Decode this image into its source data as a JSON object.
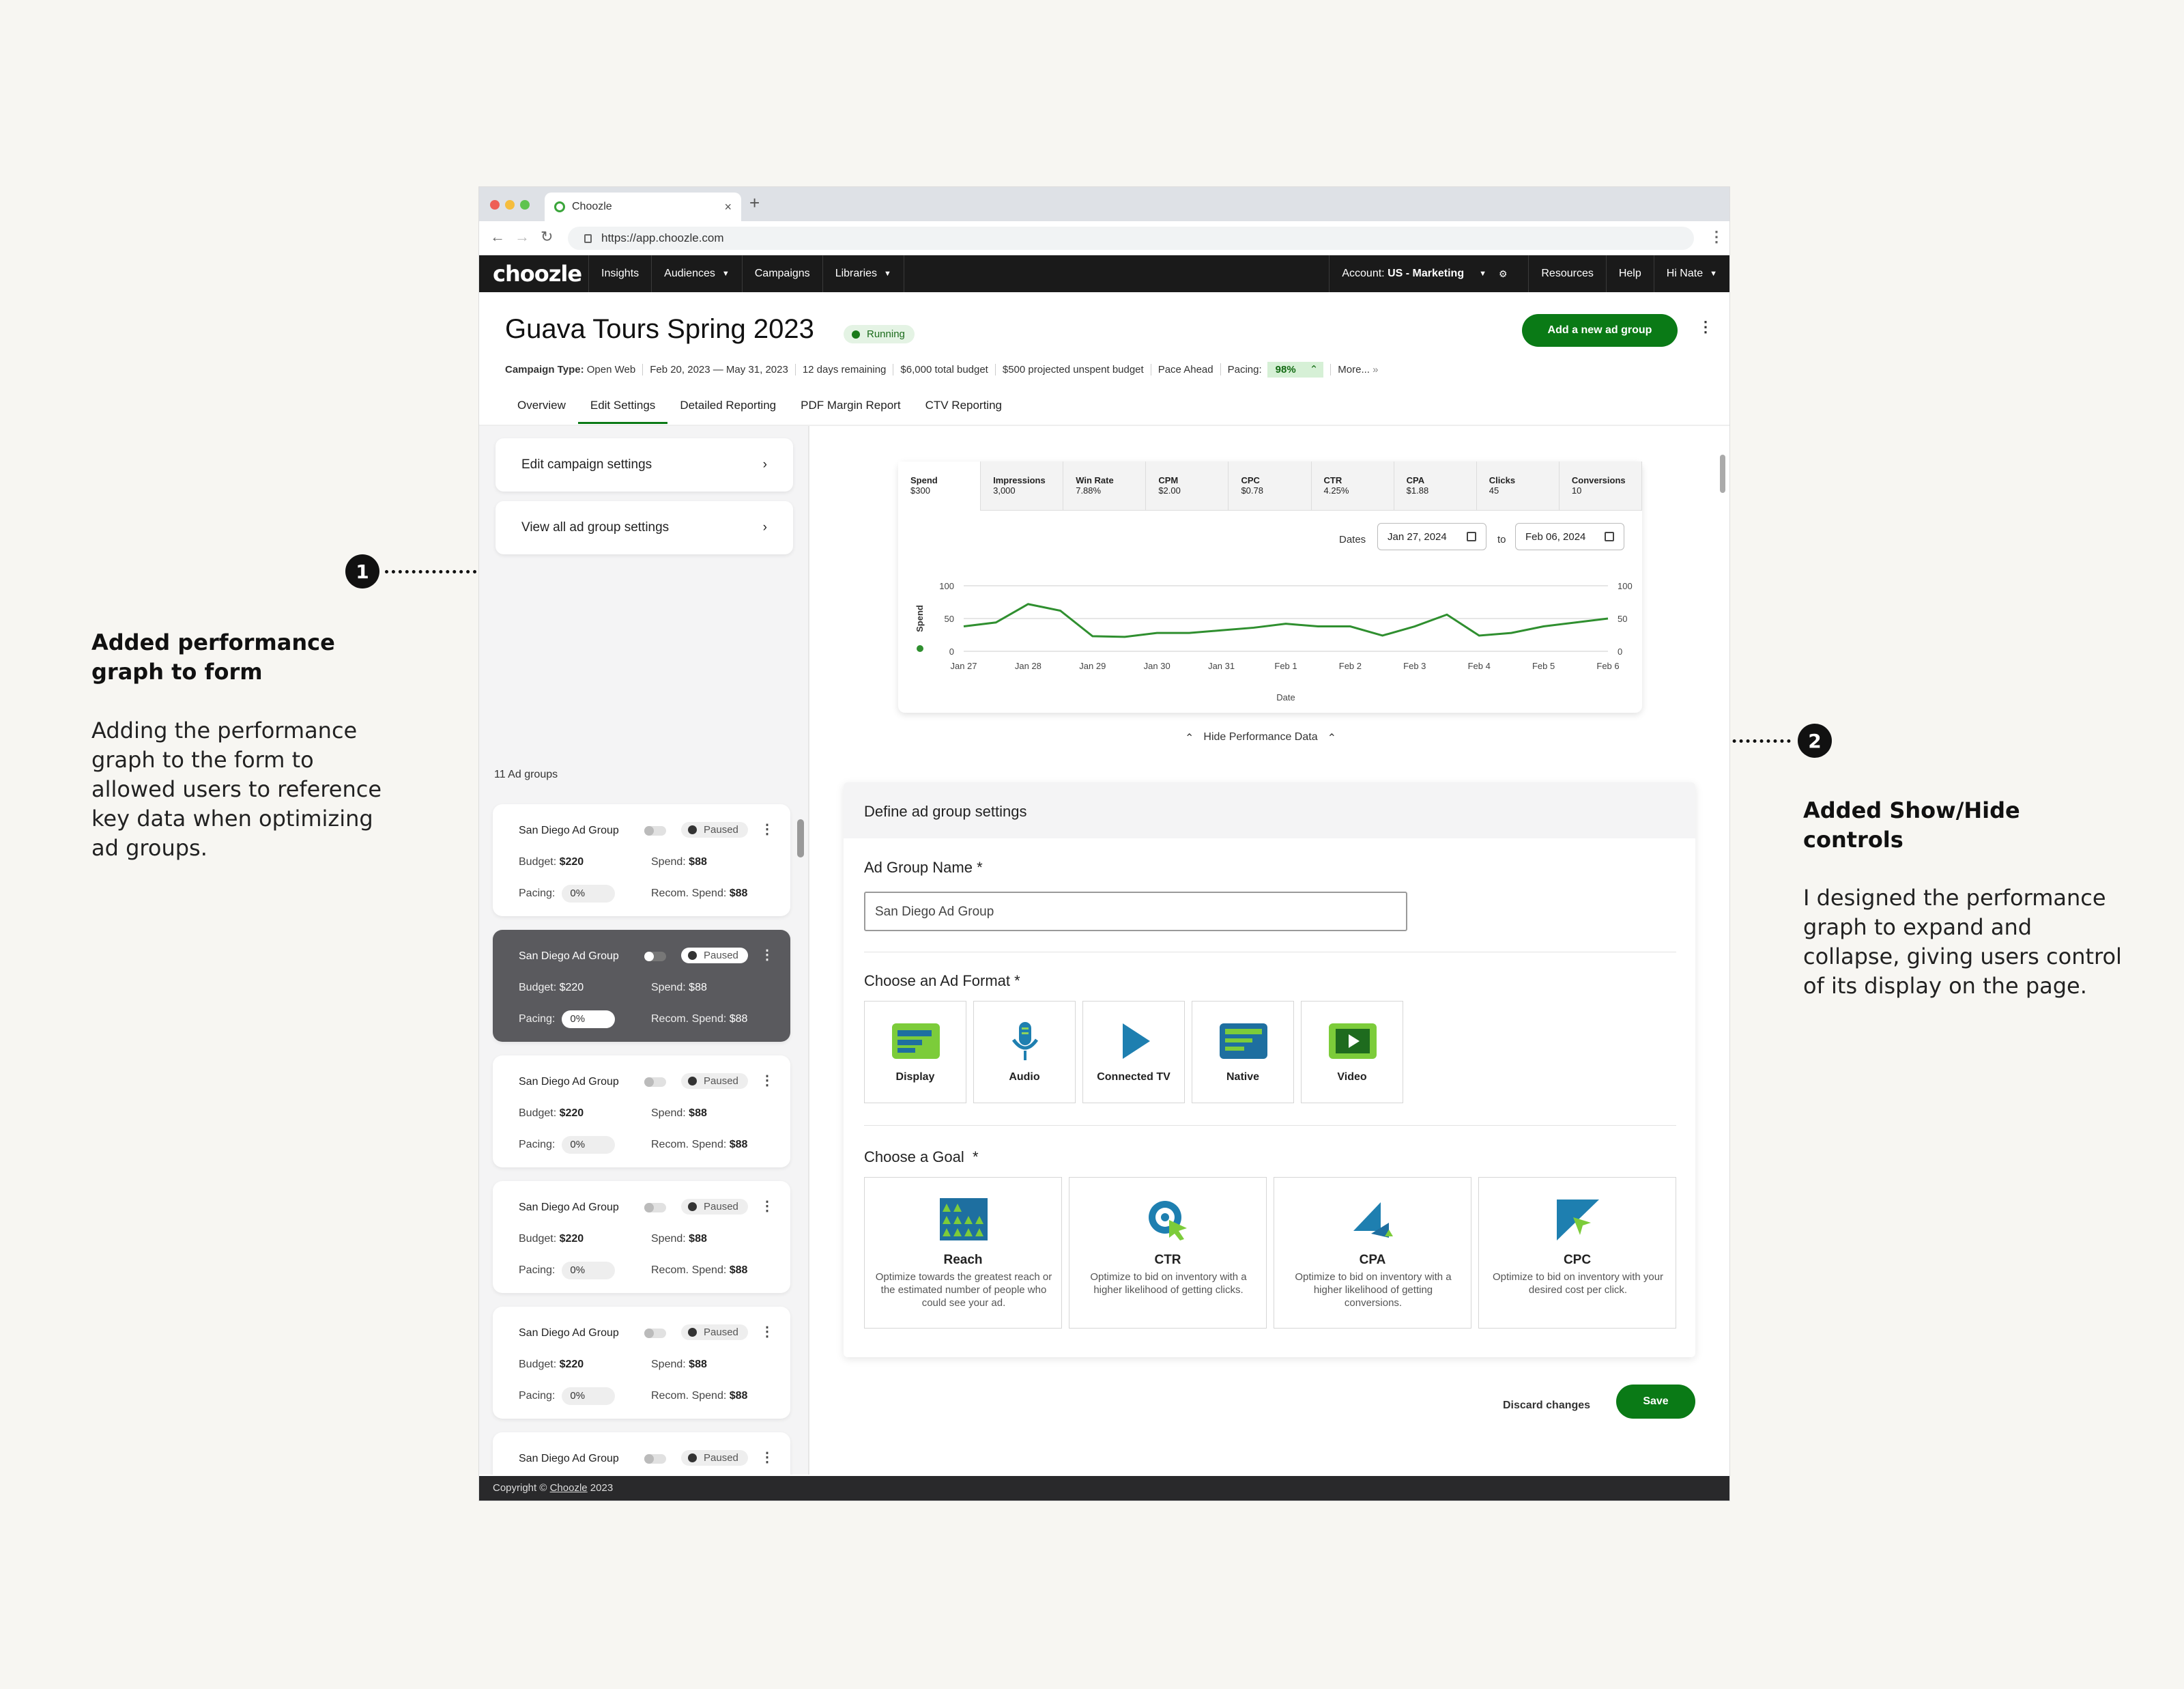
{
  "annotations": {
    "left": {
      "title": "Added performance graph to form",
      "body": "Adding the performance graph to the form to allowed users to reference key data when optimizing ad groups.",
      "badge": "1"
    },
    "right": {
      "title": "Added Show/Hide controls",
      "body": "I designed the performance graph to expand and collapse, giving users control of its display on the page.",
      "badge": "2"
    }
  },
  "browser": {
    "tab_title": "Choozle",
    "url": "https://app.choozle.com"
  },
  "nav": {
    "logo": "choozle",
    "items": [
      "Insights",
      "Audiences",
      "Campaigns",
      "Libraries"
    ],
    "account_prefix": "Account: ",
    "account_name": "US - Marketing",
    "resources": "Resources",
    "help": "Help",
    "user": "Hi Nate"
  },
  "campaign": {
    "title": "Guava Tours Spring 2023",
    "status": "Running",
    "add_button": "Add a new ad group",
    "type_label": "Campaign Type:",
    "type_value": "Open Web",
    "dates": "Feb 20, 2023 — May 31, 2023",
    "remaining": "12 days remaining",
    "budget": "$6,000 total budget",
    "unspent": "$500 projected unspent budget",
    "pace": "Pace Ahead",
    "pacing_label": "Pacing:",
    "pacing_value": "98%",
    "more": "More..."
  },
  "tabs": [
    "Overview",
    "Edit Settings",
    "Detailed Reporting",
    "PDF Margin Report",
    "CTV Reporting"
  ],
  "left_panel": {
    "edit_campaign": "Edit campaign settings",
    "view_all": "View all ad group settings",
    "count_label": "11 Ad groups",
    "card": {
      "name": "San Diego Ad Group",
      "status": "Paused",
      "budget_label": "Budget:",
      "budget": "$220",
      "spend_label": "Spend:",
      "spend": "$88",
      "pacing_label": "Pacing:",
      "pacing": "0%",
      "recom_label": "Recom. Spend:",
      "recom": "$88"
    }
  },
  "metrics": [
    {
      "label": "Spend",
      "value": "$300"
    },
    {
      "label": "Impressions",
      "value": "3,000"
    },
    {
      "label": "Win Rate",
      "value": "7.88%"
    },
    {
      "label": "CPM",
      "value": "$2.00"
    },
    {
      "label": "CPC",
      "value": "$0.78"
    },
    {
      "label": "CTR",
      "value": "4.25%"
    },
    {
      "label": "CPA",
      "value": "$1.88"
    },
    {
      "label": "Clicks",
      "value": "45"
    },
    {
      "label": "Conversions",
      "value": "10"
    }
  ],
  "date_filter": {
    "label": "Dates",
    "from": "Jan 27, 2024",
    "to_label": "to",
    "to": "Feb 06, 2024"
  },
  "chart_data": {
    "type": "line",
    "xlabel": "Date",
    "ylabel": "Spend",
    "ylim": [
      0,
      100
    ],
    "y_ticks": [
      0,
      50,
      100
    ],
    "x_tick_labels": [
      "Jan 27",
      "Jan 28",
      "Jan 29",
      "Jan 30",
      "Jan 31",
      "Feb 1",
      "Feb 2",
      "Feb 3",
      "Feb 4",
      "Feb 5",
      "Feb 6"
    ],
    "x": [
      0,
      0.5,
      1,
      1.5,
      2,
      2.5,
      3,
      3.5,
      4,
      4.5,
      5,
      5.5,
      6,
      6.5,
      7,
      7.5,
      8,
      8.5,
      9,
      9.5,
      10
    ],
    "values": [
      38,
      44,
      72,
      62,
      23,
      22,
      28,
      28,
      32,
      36,
      42,
      38,
      38,
      24,
      38,
      56,
      24,
      28,
      38,
      44,
      50
    ],
    "color": "#2f8f2f",
    "grid": true
  },
  "hide_perf": "Hide Performance Data",
  "form": {
    "section_title": "Define ad group settings",
    "name_label": "Ad Group Name",
    "name_value": "San Diego Ad Group",
    "format_label": "Choose an Ad Format",
    "formats": [
      "Display",
      "Audio",
      "Connected TV",
      "Native",
      "Video"
    ],
    "goal_label": "Choose a Goal",
    "required": "*",
    "goals": [
      {
        "title": "Reach",
        "desc": "Optimize towards the greatest reach or the estimated number of people who could see your ad."
      },
      {
        "title": "CTR",
        "desc": "Optimize to bid on inventory with a higher likelihood of getting clicks."
      },
      {
        "title": "CPA",
        "desc": "Optimize to bid on inventory with a higher likelihood of getting conversions."
      },
      {
        "title": "CPC",
        "desc": "Optimize to bid on inventory with your desired cost per click."
      }
    ],
    "discard": "Discard changes",
    "save": "Save"
  },
  "footer": {
    "prefix": "Copyright © ",
    "brand": "Choozle",
    "year": " 2023"
  }
}
